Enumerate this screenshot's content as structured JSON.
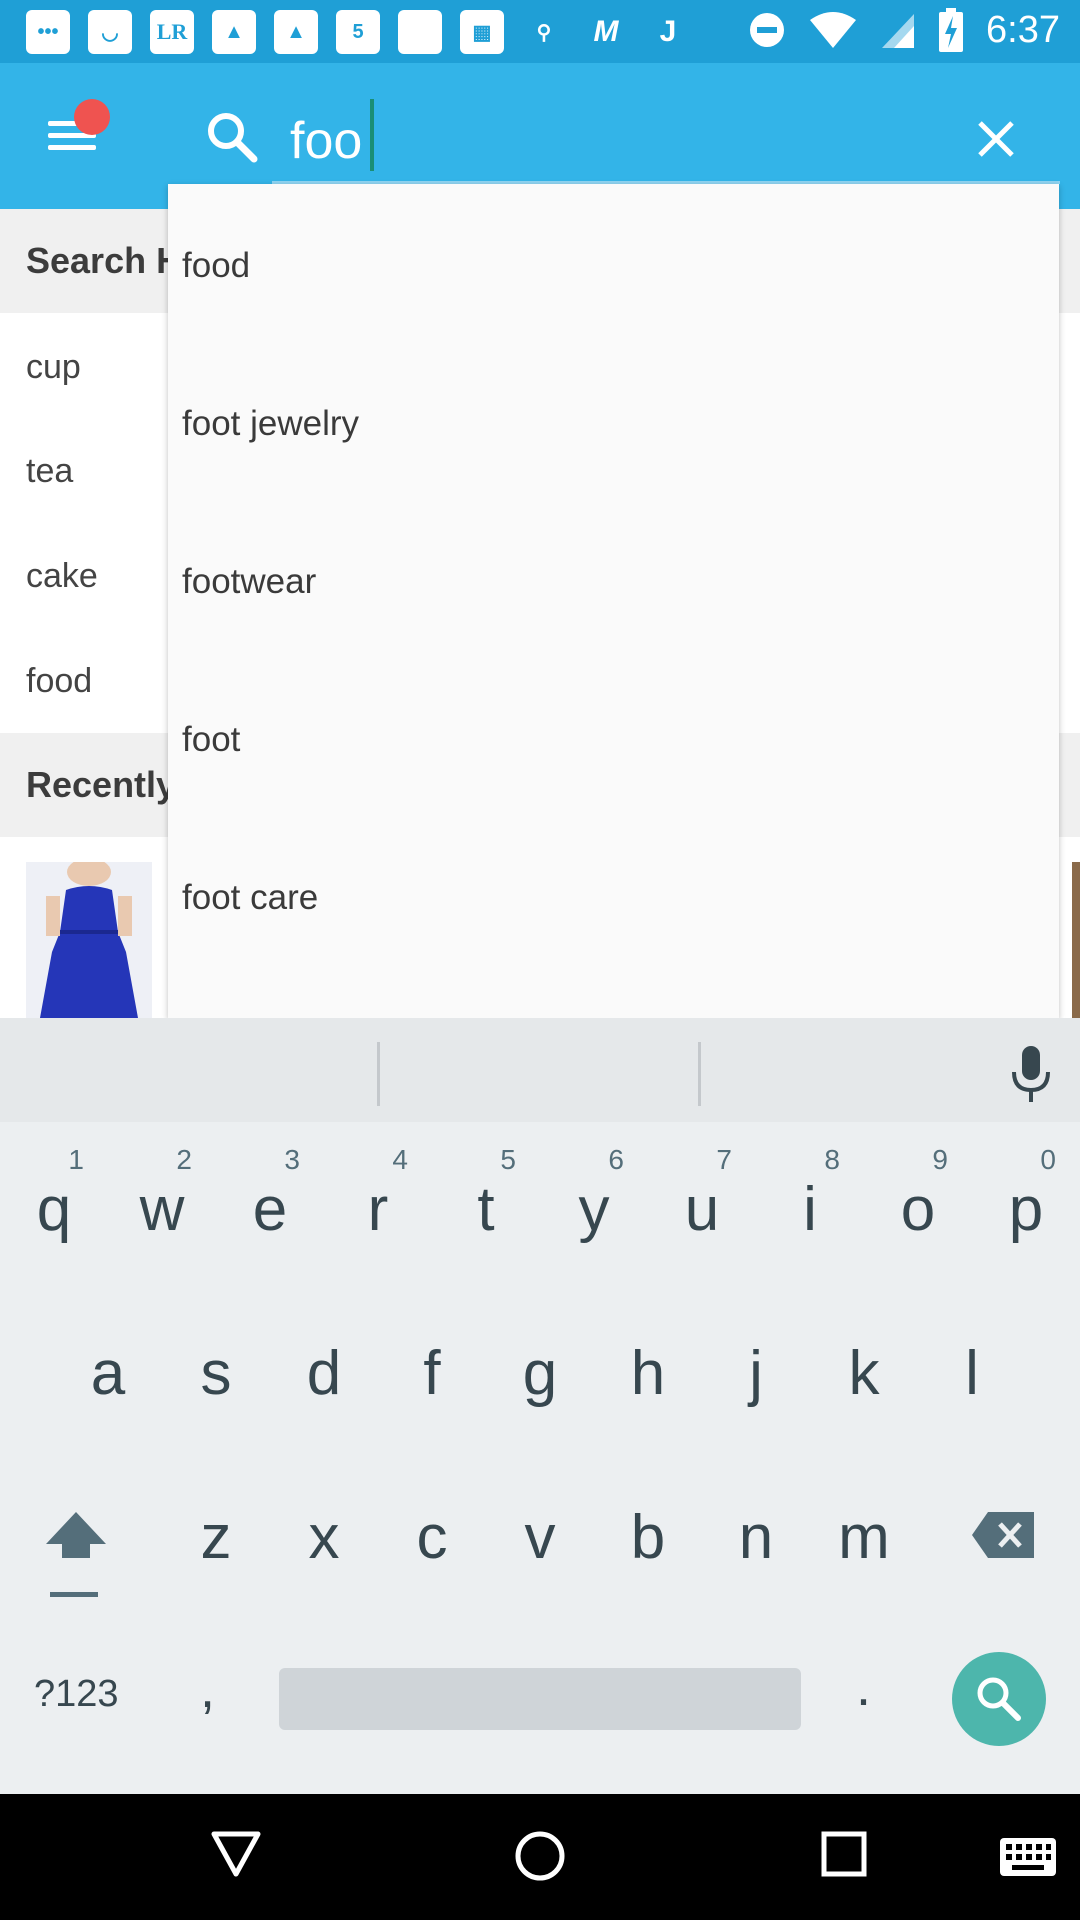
{
  "status_bar": {
    "time": "6:37",
    "left_icons": [
      "messages-icon",
      "smile-app-icon",
      "lr-app-icon",
      "drive-icon",
      "drive-icon",
      "five-app-icon",
      "blank-app-icon",
      "grid-app-icon",
      "link-app-icon",
      "m-app-icon",
      "j-app-icon"
    ],
    "lr_label": "LR",
    "five_label": "5",
    "m_label": "M",
    "j_label": "J"
  },
  "search": {
    "query": "foo"
  },
  "history": {
    "header": "Search H",
    "items": [
      "cup",
      "tea",
      "cake",
      "food"
    ]
  },
  "recent": {
    "header": "Recently"
  },
  "suggestions": [
    "food",
    "foot jewelry",
    "footwear",
    "foot",
    "foot care"
  ],
  "keyboard": {
    "row1": [
      "q",
      "w",
      "e",
      "r",
      "t",
      "y",
      "u",
      "i",
      "o",
      "p"
    ],
    "row1_hints": [
      "1",
      "2",
      "3",
      "4",
      "5",
      "6",
      "7",
      "8",
      "9",
      "0"
    ],
    "row2": [
      "a",
      "s",
      "d",
      "f",
      "g",
      "h",
      "j",
      "k",
      "l"
    ],
    "row3": [
      "z",
      "x",
      "c",
      "v",
      "b",
      "n",
      "m"
    ],
    "symbols_label": "?123",
    "comma": ",",
    "period": "."
  },
  "colors": {
    "status_bar": "#1f9fd6",
    "app_bar": "#33b4e8",
    "notification_dot": "#ef5350",
    "keyboard_bg": "#eceff1",
    "search_key": "#4db6ac"
  }
}
